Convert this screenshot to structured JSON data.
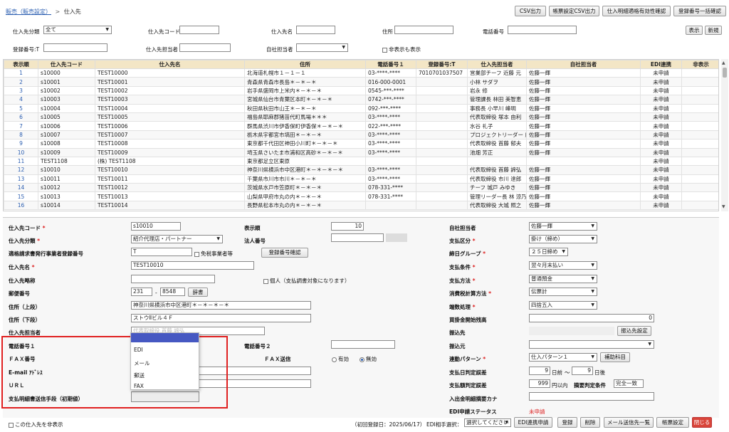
{
  "breadcrumb": {
    "parent": "販売（販売設定）",
    "sep": ">",
    "current": "仕入先"
  },
  "toolbar": [
    "CSV出力",
    "帳票設定CSV出力",
    "仕入明細適格有効性確認",
    "登録番号一括確認"
  ],
  "search": {
    "bunrui_label": "仕入先分類",
    "bunrui_value": "全て",
    "code_label": "仕入先コード",
    "name_label": "仕入先名",
    "address_label": "住所",
    "tel_label": "電話番号",
    "show_btn": "表示",
    "new_btn": "新規",
    "regno_label": "登録番号:T",
    "tanto_label": "仕入先担当者",
    "jisha_label": "自社担当者",
    "hidden_label": "非表示も表示"
  },
  "grid": {
    "headers": [
      "表示順",
      "仕入先コード",
      "仕入先名",
      "住所",
      "電話番号１",
      "登録番号:T",
      "仕入先担当者",
      "自社担当者",
      "EDI連携",
      "非表示"
    ],
    "rows": [
      [
        "1",
        "s10000",
        "TEST10000",
        "北海道札幌市１－１－１",
        "03-****-****",
        "7010701037507",
        "営業部チーフ 近藤 元",
        "佐藤一輝",
        "未申請",
        ""
      ],
      [
        "2",
        "s10001",
        "TEST10001",
        "青森県青森市長島＊－＊－＊",
        "016-000-0001",
        "",
        "小林 サダヲ",
        "佐藤一輝",
        "未申請",
        ""
      ],
      [
        "3",
        "s10002",
        "TEST10002",
        "岩手県盛岡市上米内＊－＊－＊",
        "0545-***-****",
        "",
        "岩永 修",
        "佐藤一輝",
        "未申請",
        ""
      ],
      [
        "4",
        "s10003",
        "TEST10003",
        "宮城県仙台市青葉区本町＊－＊－＊",
        "0742-***-****",
        "",
        "管理課長 林田 美智恵",
        "佐藤一輝",
        "未申請",
        ""
      ],
      [
        "5",
        "s10004",
        "TEST10004",
        "秋田県秋田市山王＊－＊－＊",
        "092-***-****",
        "",
        "事務長 小早川 峰明",
        "佐藤一輝",
        "未申請",
        ""
      ],
      [
        "6",
        "s10005",
        "TEST10005",
        "福島県耶麻郡猪苗代町馬場＊＊＊",
        "03-****-****",
        "",
        "代表取締役 塚本 由利",
        "佐藤一輝",
        "未申請",
        ""
      ],
      [
        "7",
        "s10006",
        "TEST10006",
        "群馬県渋川市伊香保町伊香保＊－＊－＊",
        "022-***-****",
        "",
        "水谷 礼子",
        "佐藤一輝",
        "未申請",
        ""
      ],
      [
        "8",
        "s10007",
        "TEST10007",
        "栃木県宇都宮市塙田＊－＊－＊",
        "03-****-****",
        "",
        "プロジェクトリーダー 広崎 圭",
        "佐藤一輝",
        "未申請",
        ""
      ],
      [
        "9",
        "s10008",
        "TEST10008",
        "東京都千代田区神田小川町＊－＊－＊",
        "03-****-****",
        "",
        "代表取締役 首藤 郁夫",
        "佐藤一輝",
        "未申請",
        ""
      ],
      [
        "10",
        "s10009",
        "TEST10009",
        "埼玉県さいたま市浦和区高砂＊－＊－＊",
        "03-****-****",
        "",
        "池畑 芳正",
        "佐藤一輝",
        "未申請",
        ""
      ],
      [
        "11",
        "TEST1108",
        "(株) TEST1108",
        "東京都足立区東原",
        "",
        "",
        "",
        "",
        "未申請",
        ""
      ],
      [
        "12",
        "s10010",
        "TEST10010",
        "神奈川県横浜市中区港町＊－＊－＊－＊",
        "03-****-****",
        "",
        "代表取締役 首藤 諦弘",
        "佐藤一輝",
        "未申請",
        ""
      ],
      [
        "13",
        "s10011",
        "TEST10011",
        "千葉県市川市市川＊－＊－＊",
        "03-****-****",
        "",
        "代表取締役 市川 達郎",
        "佐藤一輝",
        "未申請",
        ""
      ],
      [
        "14",
        "s10012",
        "TEST10012",
        "茨城県水戸市笠原町＊－＊－＊",
        "078-331-****",
        "",
        "チーフ 城戸 みゆき",
        "佐藤一輝",
        "未申請",
        ""
      ],
      [
        "15",
        "s10013",
        "TEST10013",
        "山梨県甲府市丸の内＊－＊－＊",
        "078-331-****",
        "",
        "管理リーダー長 林 涼乃",
        "佐藤一輝",
        "未申請",
        ""
      ],
      [
        "16",
        "s10014",
        "TEST10014",
        "長野県松本市丸の内＊－＊－＊",
        "",
        "",
        "代表取締役 大城 照之",
        "佐藤一輝",
        "未申請",
        ""
      ]
    ]
  },
  "detail": {
    "code_label": "仕入先コード",
    "code_value": "s10010",
    "order_label": "表示順",
    "order_value": "10",
    "bunrui_label": "仕入先分類",
    "bunrui_value": "紹介代理店・パートナー",
    "houjin_label": "法人番号",
    "tekikaku_label": "適格請求書発行事業者登録番号",
    "tekikaku_prefix": "T",
    "menzei_label": "免税事業者等",
    "confirm_btn": "登録番号確認",
    "name_label": "仕入先名",
    "name_value": "TEST10010",
    "ryaku_label": "仕入先略称",
    "kojin_label": "個人（支払調書対象になります）",
    "zip_label": "郵便番号",
    "zip1": "231",
    "zip_sep": "-",
    "zip2": "8548",
    "dict_btn": "辞書",
    "addr1_label": "住所（上段）",
    "addr1_value": "神奈川県横浜市中区港町＊－＊－＊－＊",
    "addr2_label": "住所（下段）",
    "addr2_value": "ストウⅡビル４Ｆ",
    "tanto_label": "仕入先担当者",
    "tanto_value": "代表取締役 首藤 諦弘",
    "tel1_label": "電話番号１",
    "tel2_label": "電話番号２",
    "fax_label": "ＦＡＸ番号",
    "faxsend_label": "ＦＡＸ送信",
    "fax_yes": "有効",
    "fax_no": "無効",
    "email_label": "E-mail ｱﾄﾞﾚｽ",
    "url_label": "ＵＲＬ",
    "shudan_label": "支払明細書送信手段（初期値）",
    "popup_options": [
      "EDI",
      "メール",
      "郵送",
      "FAX"
    ],
    "jisha_label": "自社担当者",
    "jisha_value": "佐藤一輝",
    "shiharai_kubun_label": "支払区分",
    "shiharai_kubun_value": "掛け（締め）",
    "shime_label": "締日グループ",
    "shime_value": "２５日締め",
    "jouken_label": "支払条件",
    "jouken_value": "翌々月末払い",
    "houhou_label": "支払方法",
    "houhou_value": "普通預金",
    "zei_label": "消費税計算方法",
    "zei_value": "伝票計",
    "hasu_label": "端数処理",
    "hasu_value": "四捨五入",
    "kaikake_label": "買掛金開始残高",
    "kaikake_value": "0",
    "furikomi_label": "振込先",
    "furikomi_btn": "振込先設定",
    "furikomimoto_label": "振込元",
    "renkei_label": "連動パターン",
    "renkei_value": "仕入パターン１",
    "hojo_btn": "補助科目",
    "hanbi_label": "支払日判定誤差",
    "hanbi_a": "9",
    "hanbi_mae": "日前",
    "hanbi_sep": "～",
    "hanbi_b": "9",
    "hanbi_ato": "日後",
    "kingaku_label": "支払額判定誤差",
    "kingaku_value": "999",
    "kingaku_unit": "円以内",
    "tekiyo_label": "摘要判定条件",
    "tekiyo_value": "完全一致",
    "kana_label": "入出金明細摘要カナ",
    "edi_label": "EDI申請ステータス",
    "edi_value": "未申請"
  },
  "footer": {
    "hide_label": "この仕入先を非表示",
    "reg_date": "（初回登録日：2025/06/17）",
    "edi_select_label": "EDI相手選択：",
    "edi_select_value": "選択してください",
    "buttons": [
      "EDI連携申請",
      "登録",
      "削除",
      "メール送信先一覧",
      "帳票設定"
    ],
    "close_btn": "閉じる",
    "colors": {
      "close_bg": "#d9453a",
      "grid_header": "#f3e6c6",
      "popup_header": "#4658c2",
      "highlight_box": "#e02020"
    }
  }
}
